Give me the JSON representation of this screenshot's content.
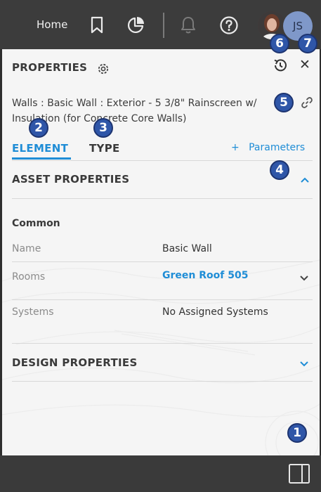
{
  "topbar": {
    "home_label": "Home",
    "icons": [
      "bookmark-icon",
      "pie-chart-icon",
      "bell-icon",
      "help-icon"
    ],
    "user_initials": "JS"
  },
  "panel": {
    "title": "PROPERTIES",
    "description": "Walls : Basic Wall : Exterior - 5 3/8\" Rainscreen w/ Insulation (for Concrete Core Walls)",
    "tabs": [
      {
        "label": "ELEMENT",
        "active": true
      },
      {
        "label": "TYPE",
        "active": false
      }
    ],
    "parameters_plus": "+",
    "parameters_label": "Parameters",
    "sections": {
      "asset": {
        "title": "ASSET PROPERTIES",
        "expanded": true
      },
      "design": {
        "title": "DESIGN PROPERTIES",
        "expanded": false
      }
    },
    "common_heading": "Common",
    "properties": [
      {
        "label": "Name",
        "value": "Basic Wall"
      },
      {
        "label": "Rooms",
        "value": "Green Roof 505"
      },
      {
        "label": "Systems",
        "value": "No Assigned Systems"
      }
    ]
  },
  "markers": [
    "1",
    "2",
    "3",
    "4",
    "5",
    "6",
    "7"
  ],
  "colors": {
    "accent": "#1f8dd6",
    "marker_fill": "#2f56a8",
    "topbar": "#3c3c3c",
    "panel": "#f5f5f5"
  }
}
